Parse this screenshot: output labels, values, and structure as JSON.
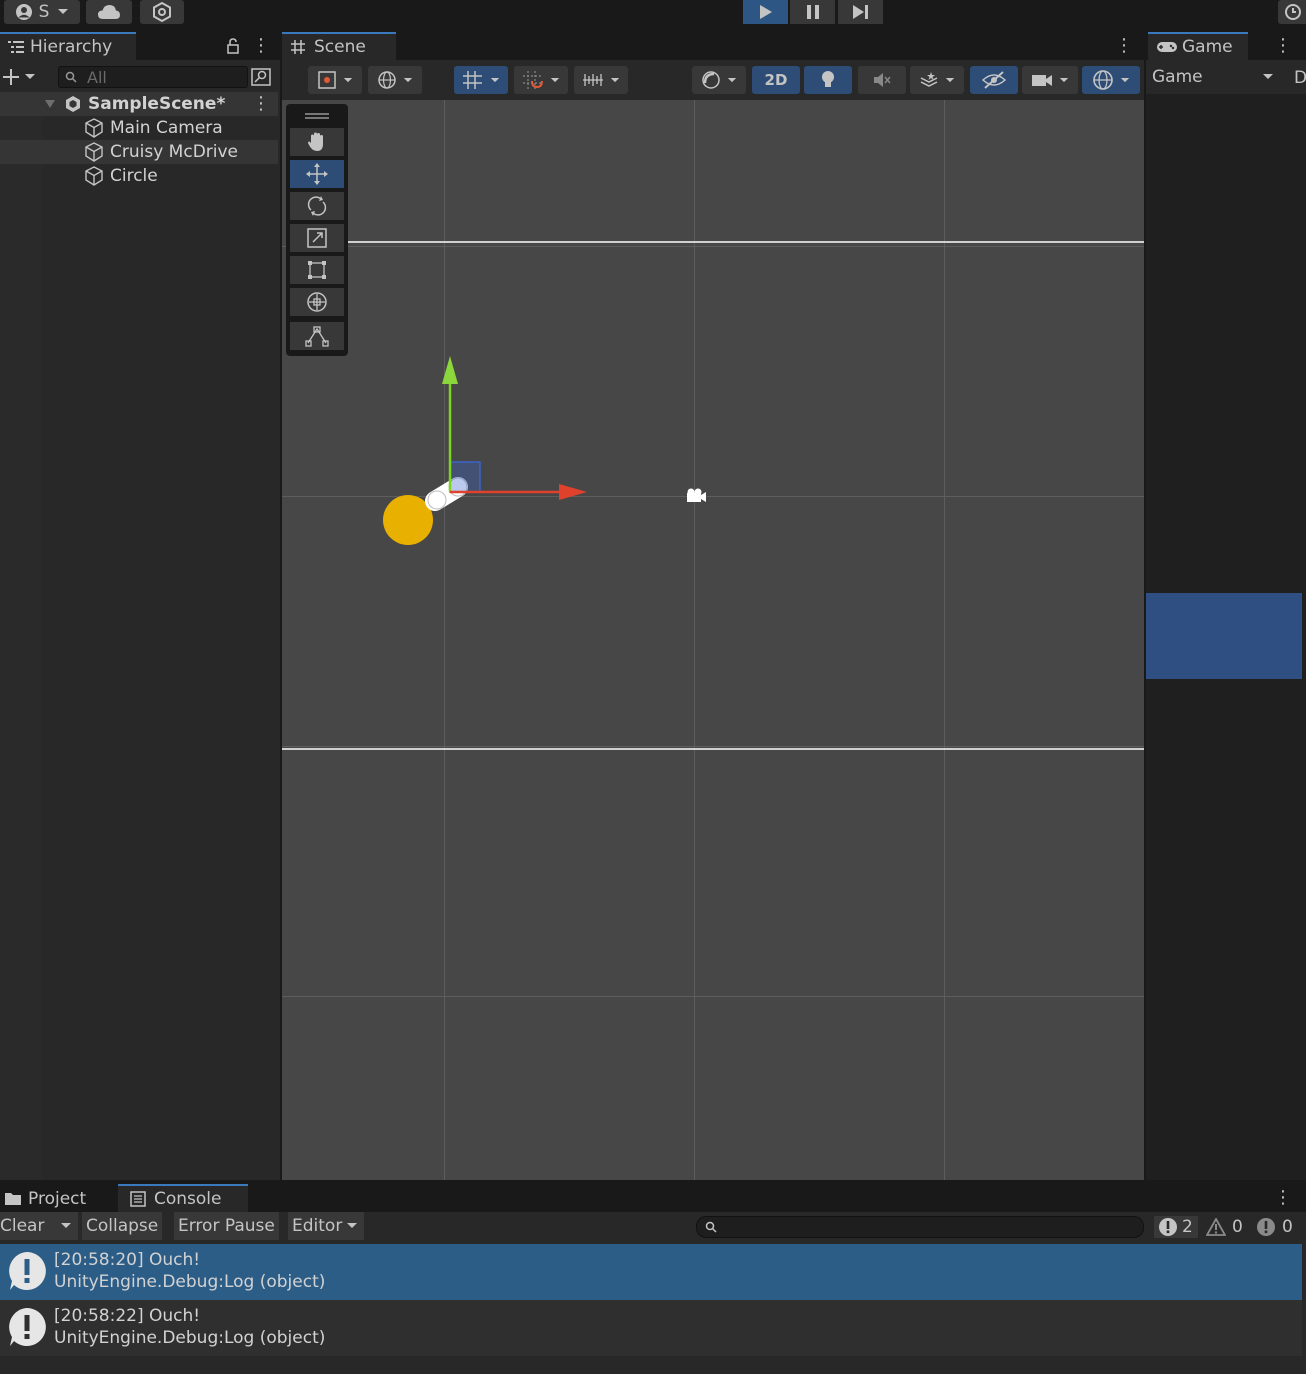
{
  "topbar": {
    "account_letter": "S",
    "account_icon": "account-icon",
    "cloud_icon": "cloud-icon",
    "collab_icon": "collab-icon",
    "play_icon": "play-icon",
    "pause_icon": "pause-icon",
    "step_icon": "step-icon",
    "history_icon": "history-icon"
  },
  "hierarchy": {
    "tab_label": "Hierarchy",
    "search_placeholder": "All",
    "scene_name": "SampleScene*",
    "items": [
      {
        "label": "Main Camera"
      },
      {
        "label": "Cruisy McDrive"
      },
      {
        "label": "Circle"
      }
    ]
  },
  "scene": {
    "tab_label": "Scene",
    "toggle_2d": "2D",
    "objects": {
      "circle_color": "#e8b000",
      "vehicle_color": "#ffffff"
    }
  },
  "game": {
    "tab_label": "Game",
    "dropdown_value": "Game",
    "partial_label": "D",
    "camera_bg_color": "#2f4f82"
  },
  "console": {
    "tabs": [
      {
        "label": "Project"
      },
      {
        "label": "Console"
      }
    ],
    "clear_label": "Clear",
    "collapse_label": "Collapse",
    "error_pause_label": "Error Pause",
    "editor_label": "Editor",
    "log_count": "2",
    "warning_count": "0",
    "error_count": "0",
    "entries": [
      {
        "line1": "[20:58:20] Ouch!",
        "line2": "UnityEngine.Debug:Log (object)"
      },
      {
        "line1": "[20:58:22] Ouch!",
        "line2": "UnityEngine.Debug:Log (object)"
      }
    ]
  },
  "colors": {
    "accent_blue": "#2d4d77",
    "selection_blue": "#2c5d87",
    "panel_bg": "#282828",
    "viewport_bg": "#474747"
  }
}
